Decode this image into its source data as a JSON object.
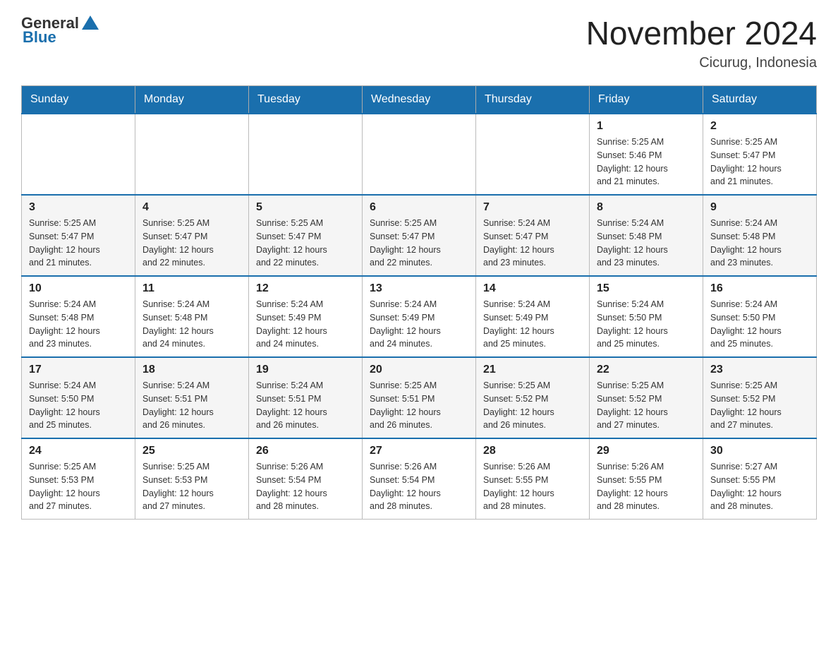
{
  "header": {
    "logo_general": "General",
    "logo_blue": "Blue",
    "title": "November 2024",
    "subtitle": "Cicurug, Indonesia"
  },
  "weekdays": [
    "Sunday",
    "Monday",
    "Tuesday",
    "Wednesday",
    "Thursday",
    "Friday",
    "Saturday"
  ],
  "weeks": [
    {
      "days": [
        {
          "num": "",
          "info": ""
        },
        {
          "num": "",
          "info": ""
        },
        {
          "num": "",
          "info": ""
        },
        {
          "num": "",
          "info": ""
        },
        {
          "num": "",
          "info": ""
        },
        {
          "num": "1",
          "info": "Sunrise: 5:25 AM\nSunset: 5:46 PM\nDaylight: 12 hours\nand 21 minutes."
        },
        {
          "num": "2",
          "info": "Sunrise: 5:25 AM\nSunset: 5:47 PM\nDaylight: 12 hours\nand 21 minutes."
        }
      ]
    },
    {
      "days": [
        {
          "num": "3",
          "info": "Sunrise: 5:25 AM\nSunset: 5:47 PM\nDaylight: 12 hours\nand 21 minutes."
        },
        {
          "num": "4",
          "info": "Sunrise: 5:25 AM\nSunset: 5:47 PM\nDaylight: 12 hours\nand 22 minutes."
        },
        {
          "num": "5",
          "info": "Sunrise: 5:25 AM\nSunset: 5:47 PM\nDaylight: 12 hours\nand 22 minutes."
        },
        {
          "num": "6",
          "info": "Sunrise: 5:25 AM\nSunset: 5:47 PM\nDaylight: 12 hours\nand 22 minutes."
        },
        {
          "num": "7",
          "info": "Sunrise: 5:24 AM\nSunset: 5:47 PM\nDaylight: 12 hours\nand 23 minutes."
        },
        {
          "num": "8",
          "info": "Sunrise: 5:24 AM\nSunset: 5:48 PM\nDaylight: 12 hours\nand 23 minutes."
        },
        {
          "num": "9",
          "info": "Sunrise: 5:24 AM\nSunset: 5:48 PM\nDaylight: 12 hours\nand 23 minutes."
        }
      ]
    },
    {
      "days": [
        {
          "num": "10",
          "info": "Sunrise: 5:24 AM\nSunset: 5:48 PM\nDaylight: 12 hours\nand 23 minutes."
        },
        {
          "num": "11",
          "info": "Sunrise: 5:24 AM\nSunset: 5:48 PM\nDaylight: 12 hours\nand 24 minutes."
        },
        {
          "num": "12",
          "info": "Sunrise: 5:24 AM\nSunset: 5:49 PM\nDaylight: 12 hours\nand 24 minutes."
        },
        {
          "num": "13",
          "info": "Sunrise: 5:24 AM\nSunset: 5:49 PM\nDaylight: 12 hours\nand 24 minutes."
        },
        {
          "num": "14",
          "info": "Sunrise: 5:24 AM\nSunset: 5:49 PM\nDaylight: 12 hours\nand 25 minutes."
        },
        {
          "num": "15",
          "info": "Sunrise: 5:24 AM\nSunset: 5:50 PM\nDaylight: 12 hours\nand 25 minutes."
        },
        {
          "num": "16",
          "info": "Sunrise: 5:24 AM\nSunset: 5:50 PM\nDaylight: 12 hours\nand 25 minutes."
        }
      ]
    },
    {
      "days": [
        {
          "num": "17",
          "info": "Sunrise: 5:24 AM\nSunset: 5:50 PM\nDaylight: 12 hours\nand 25 minutes."
        },
        {
          "num": "18",
          "info": "Sunrise: 5:24 AM\nSunset: 5:51 PM\nDaylight: 12 hours\nand 26 minutes."
        },
        {
          "num": "19",
          "info": "Sunrise: 5:24 AM\nSunset: 5:51 PM\nDaylight: 12 hours\nand 26 minutes."
        },
        {
          "num": "20",
          "info": "Sunrise: 5:25 AM\nSunset: 5:51 PM\nDaylight: 12 hours\nand 26 minutes."
        },
        {
          "num": "21",
          "info": "Sunrise: 5:25 AM\nSunset: 5:52 PM\nDaylight: 12 hours\nand 26 minutes."
        },
        {
          "num": "22",
          "info": "Sunrise: 5:25 AM\nSunset: 5:52 PM\nDaylight: 12 hours\nand 27 minutes."
        },
        {
          "num": "23",
          "info": "Sunrise: 5:25 AM\nSunset: 5:52 PM\nDaylight: 12 hours\nand 27 minutes."
        }
      ]
    },
    {
      "days": [
        {
          "num": "24",
          "info": "Sunrise: 5:25 AM\nSunset: 5:53 PM\nDaylight: 12 hours\nand 27 minutes."
        },
        {
          "num": "25",
          "info": "Sunrise: 5:25 AM\nSunset: 5:53 PM\nDaylight: 12 hours\nand 27 minutes."
        },
        {
          "num": "26",
          "info": "Sunrise: 5:26 AM\nSunset: 5:54 PM\nDaylight: 12 hours\nand 28 minutes."
        },
        {
          "num": "27",
          "info": "Sunrise: 5:26 AM\nSunset: 5:54 PM\nDaylight: 12 hours\nand 28 minutes."
        },
        {
          "num": "28",
          "info": "Sunrise: 5:26 AM\nSunset: 5:55 PM\nDaylight: 12 hours\nand 28 minutes."
        },
        {
          "num": "29",
          "info": "Sunrise: 5:26 AM\nSunset: 5:55 PM\nDaylight: 12 hours\nand 28 minutes."
        },
        {
          "num": "30",
          "info": "Sunrise: 5:27 AM\nSunset: 5:55 PM\nDaylight: 12 hours\nand 28 minutes."
        }
      ]
    }
  ]
}
